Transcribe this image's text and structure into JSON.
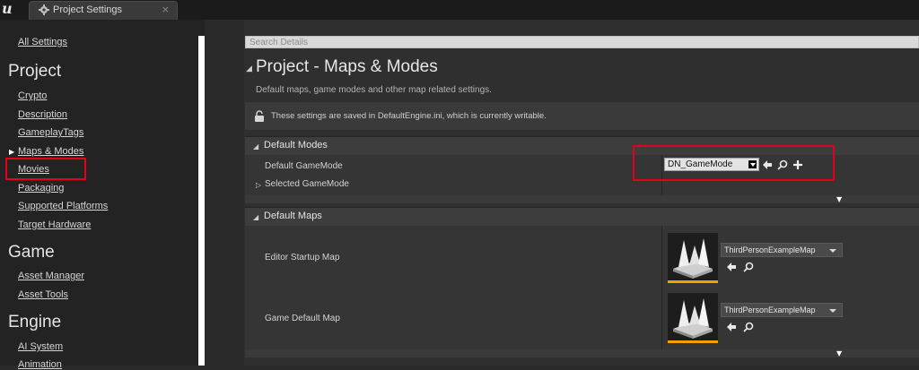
{
  "window": {
    "tab_title": "Project Settings",
    "tab_close": "×",
    "logo": "u"
  },
  "sidebar": {
    "top_link": "All Settings",
    "sections": [
      {
        "header": "Project",
        "items": [
          "Crypto",
          "Description",
          "GameplayTags",
          "Maps & Modes",
          "Movies",
          "Packaging",
          "Supported Platforms",
          "Target Hardware"
        ]
      },
      {
        "header": "Game",
        "items": [
          "Asset Manager",
          "Asset Tools"
        ]
      },
      {
        "header": "Engine",
        "items": [
          "AI System",
          "Animation"
        ]
      }
    ],
    "selected_item": "Maps & Modes"
  },
  "search": {
    "placeholder": "Search Details"
  },
  "page": {
    "title": "Project - Maps & Modes",
    "description": "Default maps, game modes and other map related settings.",
    "notice": "These settings are saved in DefaultEngine.ini, which is currently writable."
  },
  "default_modes": {
    "header": "Default Modes",
    "gamemode_label": "Default GameMode",
    "gamemode_value": "DN_GameMode",
    "selected_gamemode_label": "Selected GameMode"
  },
  "default_maps": {
    "header": "Default Maps",
    "editor_startup_label": "Editor Startup Map",
    "editor_startup_value": "ThirdPersonExampleMap",
    "game_default_label": "Game Default Map",
    "game_default_value": "ThirdPersonExampleMap"
  },
  "colors": {
    "highlight": "#e2001a",
    "thumb_accent": "#f2a100",
    "background": "#2a2a2a"
  },
  "icons": [
    "unreal-logo-icon",
    "settings-gear-icon",
    "lock-icon",
    "arrow-left-icon",
    "browse-search-icon",
    "add-plus-icon",
    "dropdown-arrow-icon",
    "map-thumbnail-icon"
  ]
}
